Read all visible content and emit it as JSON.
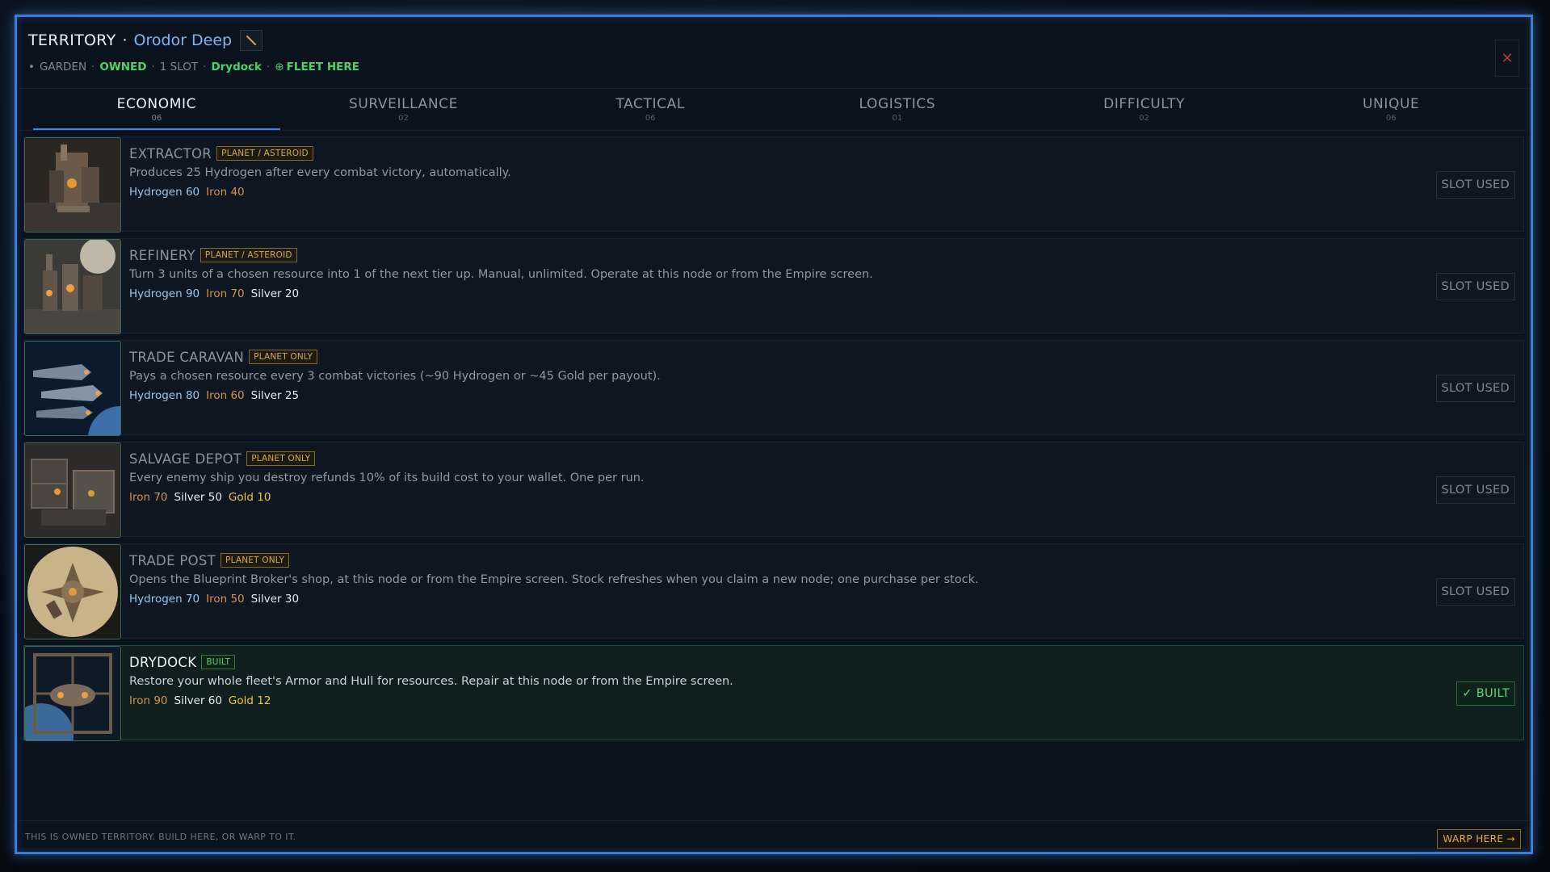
{
  "header": {
    "title": "TERRITORY",
    "separator": "·",
    "territory_name": "Orodor Deep",
    "edit_icon": "pencil-icon",
    "meta": {
      "bullet": "•",
      "type": "GARDEN",
      "sep": "·",
      "ownership": "OWNED",
      "slots": "1 SLOT",
      "built": "Drydock",
      "fleet_icon": "⊕",
      "fleet": "FLEET HERE"
    },
    "close_icon": "✕"
  },
  "tabs": [
    {
      "label": "ECONOMIC",
      "count": "06",
      "active": true
    },
    {
      "label": "SURVEILLANCE",
      "count": "02"
    },
    {
      "label": "TACTICAL",
      "count": "06"
    },
    {
      "label": "LOGISTICS",
      "count": "01"
    },
    {
      "label": "DIFFICULTY",
      "count": "02"
    },
    {
      "label": "UNIQUE",
      "count": "06"
    }
  ],
  "items": [
    {
      "name": "EXTRACTOR",
      "tag": "PLANET / ASTEROID",
      "description": "Produces 25 Hydrogen after every combat victory, automatically.",
      "costs": [
        {
          "label": "Hydrogen 60",
          "type": "hydrogen"
        },
        {
          "label": "Iron 40",
          "type": "iron"
        }
      ],
      "status": "SLOT USED"
    },
    {
      "name": "REFINERY",
      "tag": "PLANET / ASTEROID",
      "description": "Turn 3 units of a chosen resource into 1 of the next tier up. Manual, unlimited. Operate at this node or from the Empire screen.",
      "costs": [
        {
          "label": "Hydrogen 90",
          "type": "hydrogen"
        },
        {
          "label": "Iron 70",
          "type": "iron"
        },
        {
          "label": "Silver 20",
          "type": "silver"
        }
      ],
      "status": "SLOT USED"
    },
    {
      "name": "TRADE CARAVAN",
      "tag": "PLANET ONLY",
      "description": "Pays a chosen resource every 3 combat victories (~90 Hydrogen or ~45 Gold per payout).",
      "costs": [
        {
          "label": "Hydrogen 80",
          "type": "hydrogen"
        },
        {
          "label": "Iron 60",
          "type": "iron"
        },
        {
          "label": "Silver 25",
          "type": "silver"
        }
      ],
      "status": "SLOT USED"
    },
    {
      "name": "SALVAGE DEPOT",
      "tag": "PLANET ONLY",
      "description": "Every enemy ship you destroy refunds 10% of its build cost to your wallet. One per run.",
      "costs": [
        {
          "label": "Iron 70",
          "type": "iron"
        },
        {
          "label": "Silver 50",
          "type": "silver"
        },
        {
          "label": "Gold 10",
          "type": "gold"
        }
      ],
      "status": "SLOT USED"
    },
    {
      "name": "TRADE POST",
      "tag": "PLANET ONLY",
      "description": "Opens the Blueprint Broker's shop, at this node or from the Empire screen. Stock refreshes when you claim a new node; one purchase per stock.",
      "costs": [
        {
          "label": "Hydrogen 70",
          "type": "hydrogen"
        },
        {
          "label": "Iron 50",
          "type": "iron"
        },
        {
          "label": "Silver 30",
          "type": "silver"
        }
      ],
      "status": "SLOT USED"
    },
    {
      "name": "DRYDOCK",
      "tag": "BUILT",
      "description": "Restore your whole fleet's Armor and Hull for resources. Repair at this node or from the Empire screen.",
      "costs": [
        {
          "label": "Iron 90",
          "type": "iron"
        },
        {
          "label": "Silver 60",
          "type": "silver"
        },
        {
          "label": "Gold 12",
          "type": "gold"
        }
      ],
      "status": "✓ BUILT"
    }
  ],
  "footer": {
    "text": "THIS IS OWNED TERRITORY. BUILD HERE, OR WARP TO IT.",
    "warp_button": "WARP HERE →"
  },
  "colors": {
    "accent_blue": "#3a7ed8",
    "owned_green": "#4fd36a",
    "tag_amber": "#d9a947",
    "close_red": "#b9383a"
  }
}
